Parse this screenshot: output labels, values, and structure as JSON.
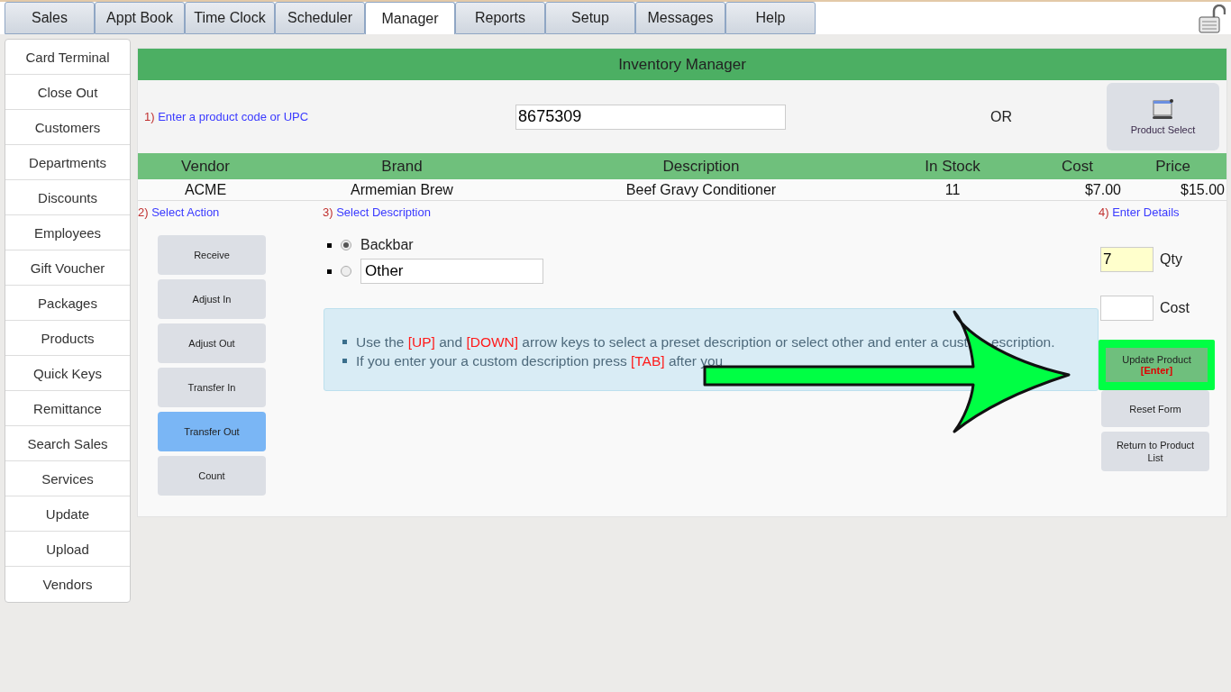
{
  "tabs": [
    {
      "label": "Sales",
      "selected": false
    },
    {
      "label": "Appt Book",
      "selected": false
    },
    {
      "label": "Time Clock",
      "selected": false
    },
    {
      "label": "Scheduler",
      "selected": false
    },
    {
      "label": "Manager",
      "selected": true
    },
    {
      "label": "Reports",
      "selected": false
    },
    {
      "label": "Setup",
      "selected": false
    },
    {
      "label": "Messages",
      "selected": false
    },
    {
      "label": "Help",
      "selected": false
    }
  ],
  "sidebar": {
    "items": [
      "Card Terminal",
      "Close Out",
      "Customers",
      "Departments",
      "Discounts",
      "Employees",
      "Gift Voucher",
      "Packages",
      "Products",
      "Quick Keys",
      "Remittance",
      "Search Sales",
      "Services",
      "Update",
      "Upload",
      "Vendors"
    ]
  },
  "panel": {
    "title": "Inventory Manager",
    "step1": {
      "number": "1)",
      "label": "Enter a product code or UPC",
      "value": "8675309",
      "or": "OR",
      "button": "Product Select"
    },
    "table": {
      "columns": [
        "Vendor",
        "Brand",
        "Description",
        "In Stock",
        "Cost",
        "Price"
      ],
      "rows": [
        [
          "ACME",
          "Armemian Brew",
          "Beef Gravy Conditioner",
          "11",
          "$7.00",
          "$15.00"
        ]
      ]
    },
    "step2": {
      "number": "2)",
      "label": "Select Action",
      "actions": [
        {
          "label": "Receive",
          "selected": false
        },
        {
          "label": "Adjust In",
          "selected": false
        },
        {
          "label": "Adjust Out",
          "selected": false
        },
        {
          "label": "Transfer In",
          "selected": false
        },
        {
          "label": "Transfer Out",
          "selected": true
        },
        {
          "label": "Count",
          "selected": false
        }
      ]
    },
    "step3": {
      "number": "3)",
      "label": "Select Description",
      "options": [
        {
          "kind": "label",
          "label": "Backbar",
          "selected": true
        },
        {
          "kind": "field",
          "value": "Other",
          "selected": false
        }
      ],
      "tips": [
        [
          {
            "kind": "plain",
            "text": "Use the "
          },
          {
            "kind": "key",
            "text": "[UP]"
          },
          {
            "kind": "plain",
            "text": " and "
          },
          {
            "kind": "key",
            "text": "[DOWN]"
          },
          {
            "kind": "plain",
            "text": " arrow keys to select a preset description or select other and enter a cust"
          },
          {
            "kind": "hidden-gap",
            "text": "escription."
          }
        ],
        [
          {
            "kind": "plain",
            "text": "If you enter your a custom description press "
          },
          {
            "kind": "key",
            "text": "[TAB]"
          },
          {
            "kind": "plain",
            "text": " after you"
          }
        ]
      ]
    },
    "step4": {
      "number": "4)",
      "label": "Enter Details",
      "qty": {
        "value": "7",
        "label": "Qty"
      },
      "cost": {
        "label": "Cost"
      },
      "update": {
        "label": "Update Product",
        "key": "[Enter]",
        "highlighted": true
      },
      "reset": "Reset Form",
      "return": "Return to Product List"
    }
  }
}
